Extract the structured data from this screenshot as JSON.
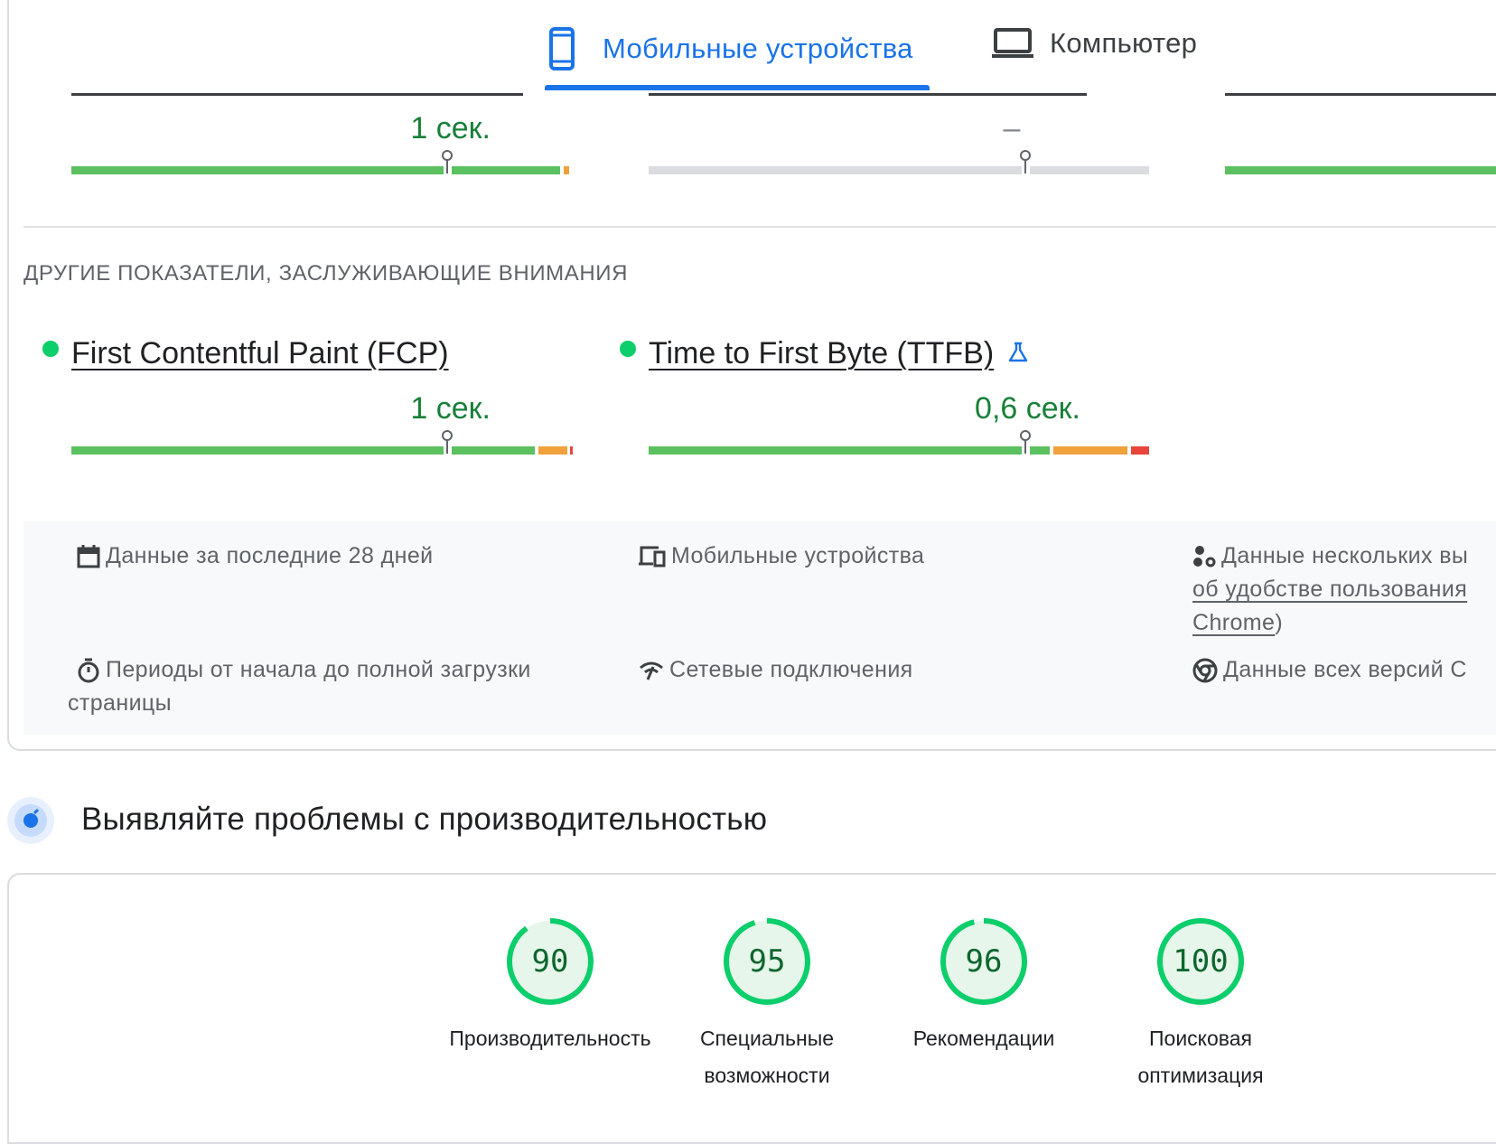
{
  "tabs": {
    "mobile": {
      "label": "Мобильные устройства",
      "active": true
    },
    "desktop": {
      "label": "Компьютер",
      "active": false
    }
  },
  "top_metrics": [
    {
      "value": "1 сек.",
      "status": "good"
    },
    {
      "value": "–",
      "status": "none"
    },
    {
      "value": "",
      "status": "good"
    }
  ],
  "other_metrics": {
    "title": "ДРУГИЕ ПОКАЗАТЕЛИ, ЗАСЛУЖИВАЮЩИЕ ВНИМАНИЯ",
    "items": [
      {
        "name": "First Contentful Paint (FCP)",
        "value": "1 сек.",
        "status": "good",
        "experimental": false
      },
      {
        "name": "Time to First Byte (TTFB)",
        "value": "0,6 сек.",
        "status": "good",
        "experimental": true
      }
    ]
  },
  "info": {
    "period": "Данные за последние 28 дней",
    "devices": "Мобильные устройства",
    "samples_prefix": "Данные нескольких вы",
    "samples_link": "об удобстве пользования",
    "samples_link2": "Chrome",
    "samples_suffix": ")",
    "durations_line1": "Периоды от начала до полной загрузки",
    "durations_line2": "страницы",
    "network": "Сетевые подключения",
    "versions": "Данные всех версий C"
  },
  "diagnose": {
    "title": "Выявляйте проблемы с производительностью"
  },
  "scores": [
    {
      "value": "90",
      "label_line1": "Производительность",
      "label_line2": "",
      "score": 90
    },
    {
      "value": "95",
      "label_line1": "Специальные",
      "label_line2": "возможности",
      "score": 95
    },
    {
      "value": "96",
      "label_line1": "Рекомендации",
      "label_line2": "",
      "score": 96
    },
    {
      "value": "100",
      "label_line1": "Поисковая",
      "label_line2": "оптимизация",
      "score": 100
    }
  ],
  "colors": {
    "accent": "#1a73e8",
    "good": "#0cce6b",
    "bar_good": "#5bc05f",
    "bar_average": "#f0a13c",
    "bar_poor": "#e8453c",
    "bar_none": "#dadce0",
    "score_text": "#0d652d"
  }
}
